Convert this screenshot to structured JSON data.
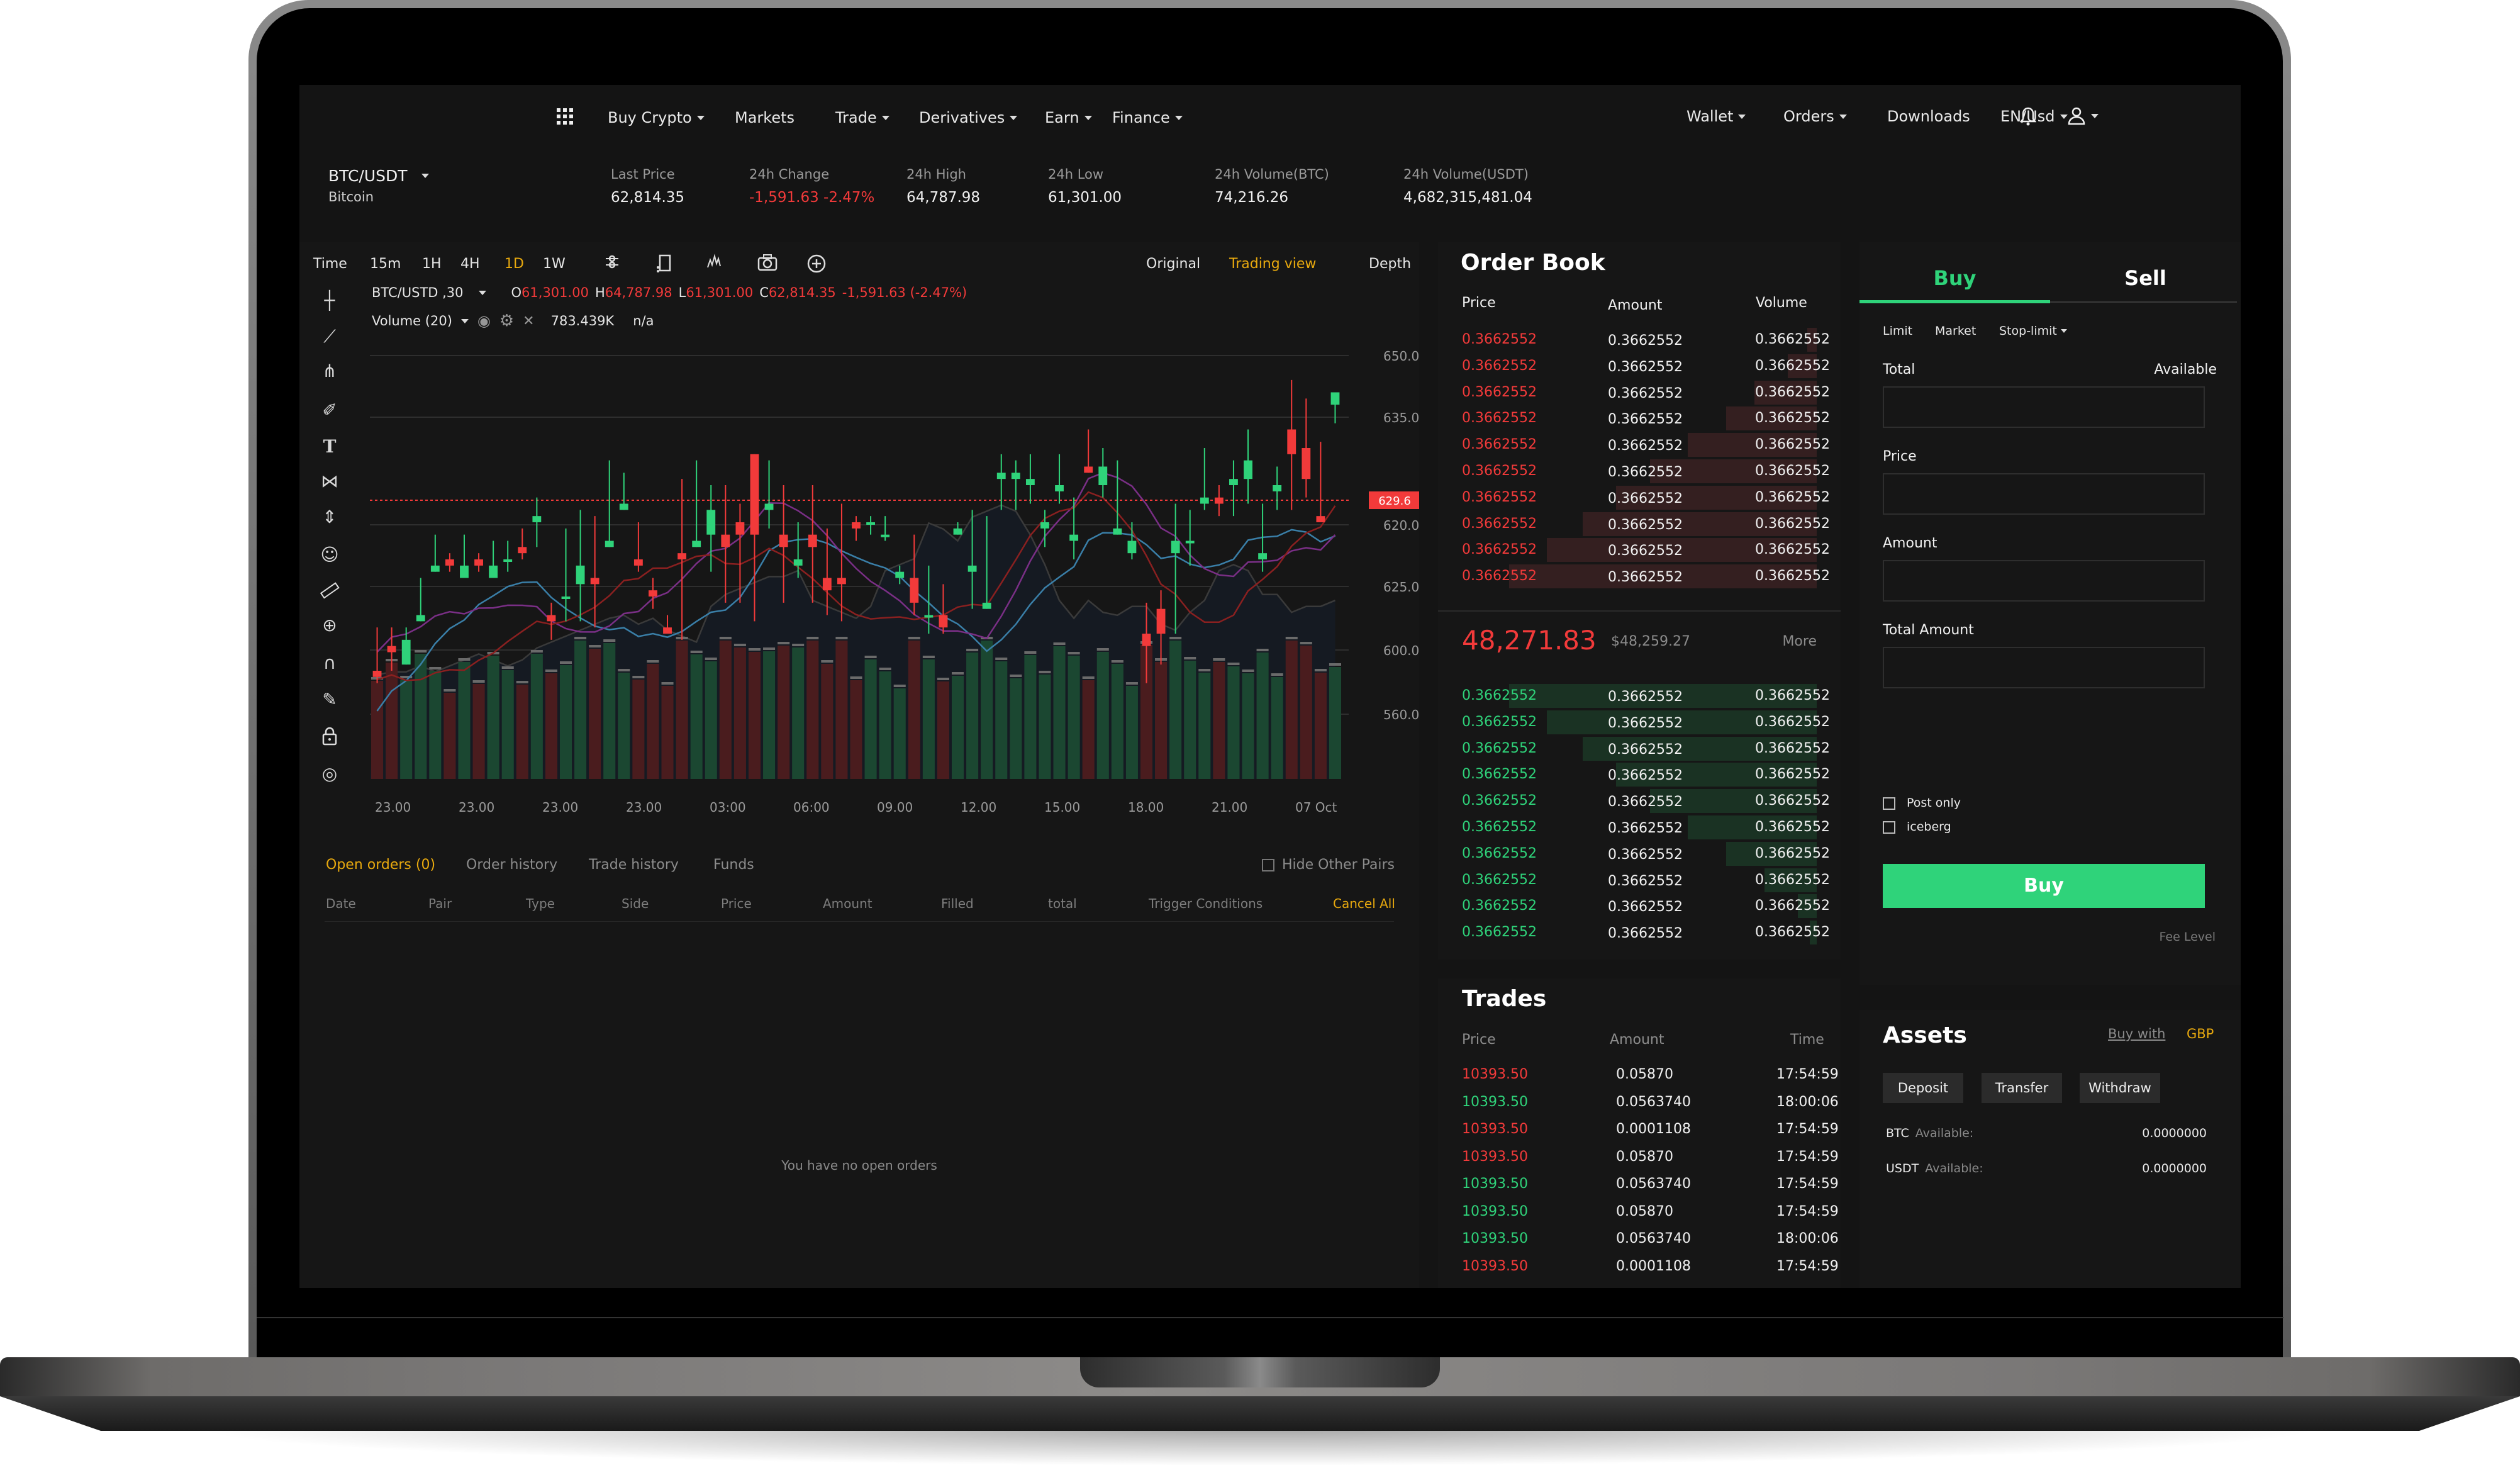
{
  "nav": {
    "left": [
      {
        "label": "Buy Crypto",
        "dropdown": true
      },
      {
        "label": "Markets",
        "dropdown": false
      },
      {
        "label": "Trade",
        "dropdown": true
      },
      {
        "label": "Derivatives",
        "dropdown": true
      },
      {
        "label": "Earn",
        "dropdown": true
      },
      {
        "label": "Finance",
        "dropdown": true
      }
    ],
    "right": [
      {
        "label": "Wallet",
        "dropdown": true
      },
      {
        "label": "Orders",
        "dropdown": true
      },
      {
        "label": "Downloads",
        "dropdown": false
      },
      {
        "label": "EN/Usd",
        "dropdown": true
      }
    ],
    "icons": [
      "apps-grid-icon",
      "bell-icon",
      "user-icon"
    ]
  },
  "ticker": {
    "pair": "BTC/USDT",
    "name": "Bitcoin",
    "stats": [
      {
        "label": "Last Price",
        "value": "62,814.35",
        "color": "default"
      },
      {
        "label": "24h Change",
        "value": "-1,591.63 -2.47%",
        "color": "red"
      },
      {
        "label": "24h High",
        "value": "64,787.98",
        "color": "default"
      },
      {
        "label": "24h Low",
        "value": "61,301.00",
        "color": "default"
      },
      {
        "label": "24h Volume(BTC)",
        "value": "74,216.26",
        "color": "default"
      },
      {
        "label": "24h Volume(USDT)",
        "value": "4,682,315,481.04",
        "color": "default"
      }
    ]
  },
  "chart_toolbar": {
    "intervals": [
      "Time",
      "15m",
      "1H",
      "4H",
      "1D",
      "1W"
    ],
    "active_interval": "1D",
    "tool_icons": [
      "indicator-settings-icon",
      "fullscreen-icon",
      "indicators-icon",
      "camera-icon",
      "add-circle-icon"
    ],
    "views": [
      "Original",
      "Trading view",
      "Depth"
    ],
    "active_view": "Trading view"
  },
  "legend": {
    "symbol": "BTC/USTD ,30",
    "open_label": "O",
    "open": "61,301.00",
    "high_label": "H",
    "high": "64,787.98",
    "low_label": "L",
    "low": "61,301.00",
    "close_label": "C",
    "close": "62,814.35",
    "change": "-1,591.63 (-2.47%)",
    "volume_label": "Volume (20)",
    "volume_value": "783.439K",
    "volume_extra": "n/a"
  },
  "drawing_tools": [
    "crosshair-icon",
    "trend-line-icon",
    "pitchfork-icon",
    "brush-icon",
    "text-icon",
    "pattern-icon",
    "measure-icon",
    "emoji-icon",
    "ruler-icon",
    "zoom-in-icon",
    "magnet-icon",
    "pencil-icon",
    "lock-icon",
    "eye-icon"
  ],
  "chart_data": {
    "type": "candlestick",
    "title": "BTC/USTD ,30",
    "y_ticks": [
      "650.00",
      "635.00",
      "620.00",
      "625.00",
      "600.00",
      "560.00"
    ],
    "x_ticks": [
      "23.00",
      "23.00",
      "23.00",
      "23.00",
      "03:00",
      "06:00",
      "09.00",
      "12.00",
      "15.00",
      "18.00",
      "21.00",
      "07 Oct"
    ],
    "last_price_label": "629.6",
    "last_price_color": "#f23a3a",
    "ylim": [
      600,
      660
    ],
    "candles": [
      [
        606,
        605,
        613,
        604
      ],
      [
        610,
        609,
        613,
        606
      ],
      [
        607,
        611,
        613,
        607
      ],
      [
        614,
        615,
        621,
        614
      ],
      [
        622,
        623,
        628,
        622
      ],
      [
        624,
        623,
        625,
        622
      ],
      [
        621,
        623,
        628,
        622
      ],
      [
        624,
        623,
        625,
        622
      ],
      [
        621,
        623,
        627,
        622
      ],
      [
        624,
        624,
        627,
        622
      ],
      [
        626,
        625,
        629,
        624
      ],
      [
        630,
        631,
        634,
        626
      ],
      [
        615,
        614,
        617,
        611
      ],
      [
        618,
        618,
        629,
        614
      ],
      [
        620,
        623,
        632,
        614
      ],
      [
        621,
        620,
        631,
        613
      ],
      [
        626,
        627,
        640,
        629
      ],
      [
        632,
        633,
        638,
        633
      ],
      [
        624,
        623,
        630,
        622
      ],
      [
        619,
        618,
        621,
        616
      ],
      [
        613,
        612,
        615,
        613
      ],
      [
        625,
        624,
        637,
        611
      ],
      [
        626,
        627,
        640,
        629
      ],
      [
        628,
        632,
        636,
        622
      ],
      [
        628,
        626,
        636,
        617
      ],
      [
        630,
        628,
        633,
        617
      ],
      [
        641,
        628,
        634,
        614
      ],
      [
        632,
        633,
        640,
        629
      ],
      [
        628,
        626,
        636,
        617
      ],
      [
        623,
        624,
        630,
        621
      ],
      [
        628,
        626,
        636,
        617
      ],
      [
        621,
        619,
        629,
        615
      ],
      [
        621,
        620,
        633,
        614
      ],
      [
        630,
        629,
        631,
        627
      ],
      [
        630,
        630,
        631,
        628
      ],
      [
        628,
        628,
        631,
        627
      ],
      [
        621,
        622,
        623,
        620
      ],
      [
        621,
        617,
        628,
        615
      ],
      [
        615,
        615,
        623,
        612
      ],
      [
        615,
        613,
        620,
        612
      ],
      [
        628,
        629,
        630,
        629
      ],
      [
        622,
        623,
        632,
        616
      ],
      [
        616,
        617,
        631,
        616
      ],
      [
        637,
        638,
        641,
        632
      ],
      [
        637,
        638,
        640,
        632
      ],
      [
        636,
        637,
        641,
        633
      ],
      [
        629,
        630,
        632,
        626
      ],
      [
        635,
        636,
        641,
        633
      ],
      [
        627,
        628,
        634,
        624
      ],
      [
        639,
        638,
        645,
        639
      ],
      [
        636,
        639,
        642,
        634
      ],
      [
        628,
        629,
        640,
        631
      ],
      [
        625,
        627,
        630,
        624
      ],
      [
        612,
        610,
        617,
        604
      ],
      [
        616,
        612,
        619,
        607
      ],
      [
        625,
        627,
        633,
        612
      ],
      [
        627,
        627,
        632,
        623
      ],
      [
        633,
        634,
        642,
        632
      ],
      [
        634,
        633,
        636,
        631
      ],
      [
        636,
        637,
        640,
        631
      ],
      [
        637,
        640,
        645,
        633
      ],
      [
        624,
        625,
        633,
        622
      ],
      [
        635,
        636,
        639,
        632
      ],
      [
        645,
        641,
        653,
        632
      ],
      [
        642,
        637,
        650,
        634
      ],
      [
        631,
        630,
        643,
        632
      ],
      [
        649,
        651,
        650,
        646
      ]
    ],
    "volume_colors": "candle direction",
    "series": [
      {
        "name": "MA-blue",
        "color": "#3a7fa8"
      },
      {
        "name": "MA-purple",
        "color": "#7a2f86"
      },
      {
        "name": "MA-darkred",
        "color": "#8a2020"
      }
    ]
  },
  "orders": {
    "tabs": [
      "Open orders (0)",
      "Order history",
      "Trade history",
      "Funds"
    ],
    "active_tab": "Open orders (0)",
    "hide_other_pairs": "Hide Other Pairs",
    "columns": [
      "Date",
      "Pair",
      "Type",
      "Side",
      "Price",
      "Amount",
      "Filled",
      "total",
      "Trigger Conditions"
    ],
    "cancel_all": "Cancel All",
    "empty_message": "You have no open orders"
  },
  "order_book": {
    "title": "Order Book",
    "columns": [
      "Price",
      "Amount",
      "Volume"
    ],
    "asks": [
      {
        "price": "0.3662552",
        "amount": "0.3662552",
        "volume": "0.3662552",
        "depth": 0.04
      },
      {
        "price": "0.3662552",
        "amount": "0.3662552",
        "volume": "0.3662552",
        "depth": 0.12
      },
      {
        "price": "0.3662552",
        "amount": "0.3662552",
        "volume": "0.3662552",
        "depth": 0.26
      },
      {
        "price": "0.3662552",
        "amount": "0.3662552",
        "volume": "0.3662552",
        "depth": 0.38
      },
      {
        "price": "0.3662552",
        "amount": "0.3662552",
        "volume": "0.3662552",
        "depth": 0.54
      },
      {
        "price": "0.3662552",
        "amount": "0.3662552",
        "volume": "0.3662552",
        "depth": 0.7
      },
      {
        "price": "0.3662552",
        "amount": "0.3662552",
        "volume": "0.3662552",
        "depth": 0.84
      },
      {
        "price": "0.3662552",
        "amount": "0.3662552",
        "volume": "0.3662552",
        "depth": 0.98
      },
      {
        "price": "0.3662552",
        "amount": "0.3662552",
        "volume": "0.3662552",
        "depth": 1.13
      },
      {
        "price": "0.3662552",
        "amount": "0.3662552",
        "volume": "0.3662552",
        "depth": 1.29
      }
    ],
    "last_price": "48,271.83",
    "last_price_usd": "$48,259.27",
    "more": "More",
    "bids": [
      {
        "price": "0.3662552",
        "amount": "0.3662552",
        "volume": "0.3662552",
        "depth": 1.29
      },
      {
        "price": "0.3662552",
        "amount": "0.3662552",
        "volume": "0.3662552",
        "depth": 1.13
      },
      {
        "price": "0.3662552",
        "amount": "0.3662552",
        "volume": "0.3662552",
        "depth": 0.98
      },
      {
        "price": "0.3662552",
        "amount": "0.3662552",
        "volume": "0.3662552",
        "depth": 0.84
      },
      {
        "price": "0.3662552",
        "amount": "0.3662552",
        "volume": "0.3662552",
        "depth": 0.7
      },
      {
        "price": "0.3662552",
        "amount": "0.3662552",
        "volume": "0.3662552",
        "depth": 0.54
      },
      {
        "price": "0.3662552",
        "amount": "0.3662552",
        "volume": "0.3662552",
        "depth": 0.38
      },
      {
        "price": "0.3662552",
        "amount": "0.3662552",
        "volume": "0.3662552",
        "depth": 0.22
      },
      {
        "price": "0.3662552",
        "amount": "0.3662552",
        "volume": "0.3662552",
        "depth": 0.08
      },
      {
        "price": "0.3662552",
        "amount": "0.3662552",
        "volume": "0.3662552",
        "depth": 0.03
      }
    ]
  },
  "trades": {
    "title": "Trades",
    "columns": [
      "Price",
      "Amount",
      "Time"
    ],
    "rows": [
      {
        "price": "10393.50",
        "side": "sell",
        "amount": "0.05870",
        "time": "17:54:59"
      },
      {
        "price": "10393.50",
        "side": "buy",
        "amount": "0.0563740",
        "time": "18:00:06"
      },
      {
        "price": "10393.50",
        "side": "sell",
        "amount": "0.0001108",
        "time": "17:54:59"
      },
      {
        "price": "10393.50",
        "side": "sell",
        "amount": "0.05870",
        "time": "17:54:59"
      },
      {
        "price": "10393.50",
        "side": "buy",
        "amount": "0.0563740",
        "time": "17:54:59"
      },
      {
        "price": "10393.50",
        "side": "buy",
        "amount": "0.05870",
        "time": "17:54:59"
      },
      {
        "price": "10393.50",
        "side": "buy",
        "amount": "0.0563740",
        "time": "18:00:06"
      },
      {
        "price": "10393.50",
        "side": "sell",
        "amount": "0.0001108",
        "time": "17:54:59"
      }
    ]
  },
  "trade_form": {
    "tabs": [
      "Buy",
      "Sell"
    ],
    "active_tab": "Buy",
    "order_types": [
      "Limit",
      "Market",
      "Stop-limit"
    ],
    "total_label": "Total",
    "available_label": "Available",
    "fields": [
      {
        "label": "Total",
        "value": "",
        "placeholder": ""
      },
      {
        "label": "Price",
        "value": "",
        "placeholder": ""
      },
      {
        "label": "Amount",
        "value": "",
        "placeholder": ""
      },
      {
        "label": "Total Amount",
        "value": "",
        "placeholder": ""
      }
    ],
    "checkboxes": [
      {
        "label": "Post only",
        "checked": false
      },
      {
        "label": "iceberg",
        "checked": false
      }
    ],
    "submit": "Buy",
    "fee_level": "Fee Level",
    "accent": "#2fd37a"
  },
  "assets": {
    "title": "Assets",
    "buy_with": "Buy with",
    "currency": "GBP",
    "buttons": [
      "Deposit",
      "Transfer",
      "Withdraw"
    ],
    "balances": [
      {
        "coin": "BTC",
        "label": "Available:",
        "value": "0.0000000"
      },
      {
        "coin": "USDT",
        "label": "Available:",
        "value": "0.0000000"
      }
    ]
  }
}
